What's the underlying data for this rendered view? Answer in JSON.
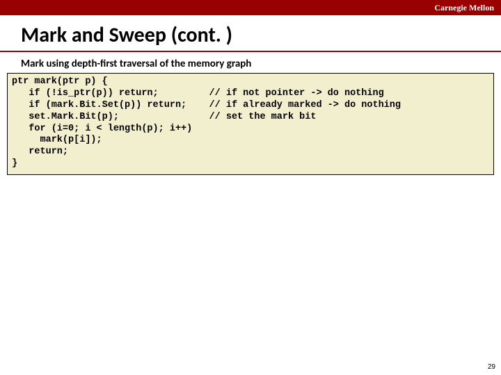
{
  "header": {
    "brand": "Carnegie Mellon"
  },
  "slide": {
    "title": "Mark and Sweep (cont. )",
    "subtitle": "Mark using depth-first traversal of the memory graph",
    "code": "ptr mark(ptr p) {\n   if (!is_ptr(p)) return;         // if not pointer -> do nothing\n   if (mark.Bit.Set(p)) return;    // if already marked -> do nothing\n   set.Mark.Bit(p);                // set the mark bit\n   for (i=0; i < length(p); i++)\n     mark(p[i]);\n   return;\n}",
    "page_number": "29"
  }
}
